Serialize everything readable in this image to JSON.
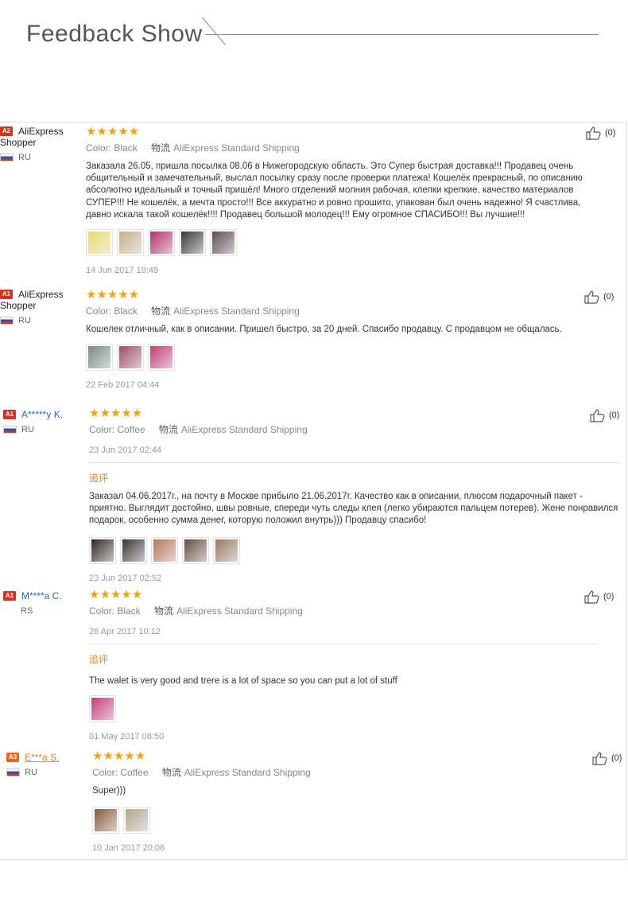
{
  "header": {
    "title": "Feedback Show"
  },
  "reviews": [
    {
      "level": "A2",
      "buyer_line1": "AliExpress",
      "buyer_line2": "Shopper",
      "country": "RU",
      "rating": "★★★★★",
      "color_label": "Color:",
      "color_value": "Black",
      "shipping_label": "物流",
      "shipping_value": "AliExpress Standard Shipping",
      "text": "Заказала 26.05, пришла посылка 08.06 в Нижегородскую область. Это Супер быстрая доставка!!! Продавец очень общительный и замечательный, выслал посылку сразу после проверки платежа! Кошелёк прекрасный, по описанию абсолютно идеальный и точный пришёл! Много отделений молния рабочая, клепки крепкие, качество материалов СУПЕР!!! Не кошелёк, а мечта просто!!! Все аккуратно и ровно прошито, упакован был очень надежно! Я счастлива, давно искала такой кошелёк!!!! Продавец большой молодец!!! Ему огромное СПАСИБО!!! Вы лучшие!!!",
      "date": "14 Jun 2017 19:49",
      "likes": "(0)",
      "thumb_colors": [
        "#e9dc6a",
        "#c9b08a",
        "#b52f6e",
        "#3a3535",
        "#5a4b57"
      ]
    },
    {
      "level": "A1",
      "buyer_line1": "AliExpress",
      "buyer_line2": "Shopper",
      "country": "RU",
      "rating": "★★★★★",
      "color_label": "Color:",
      "color_value": "Black",
      "shipping_label": "物流",
      "shipping_value": "AliExpress Standard Shipping",
      "text": "Кошелек отличный, как в описании. Пришел быстро, за 20 дней. Спасибо продавцу. С продавцом не общалась.",
      "date": "22 Feb 2017 04:44",
      "likes": "(0)",
      "thumb_colors": [
        "#7a8a86",
        "#a04a6a",
        "#c23a7a"
      ]
    },
    {
      "level": "A1",
      "buyer_name": "A*****y K.",
      "country": "RU",
      "rating": "★★★★★",
      "color_label": "Color:",
      "color_value": "Coffee",
      "shipping_label": "物流",
      "shipping_value": "AliExpress Standard Shipping",
      "date": "23 Jun 2017 02:44",
      "append_label": "追评",
      "text": "Заказал 04.06.2017г., на почту в Москве прибыло 21.06.2017г. Качество как в описании, плюсом подарочный пакет - приятно. Выглядит достойно, швы ровные, спереди чуть следы клея (легко убираются пальцем потерев). Жене понравился подарок, особенно сумма денег, которую положил внутрь))) Продавцу спасибо!",
      "append_date": "23 Jun 2017 02:52",
      "likes": "(0)",
      "thumb_colors": [
        "#2e2a22",
        "#3a3632",
        "#b8775e",
        "#6a4e3e",
        "#9a7a66"
      ]
    },
    {
      "level": "A1",
      "buyer_name": "M****a C.",
      "country": "RS",
      "rating": "★★★★★",
      "color_label": "Color:",
      "color_value": "Black",
      "shipping_label": "物流",
      "shipping_value": "AliExpress Standard Shipping",
      "date": "26 Apr 2017 10:12",
      "append_label": "追评",
      "text": "The walet is very good and trere is a lot of space so you can put a lot of stuff",
      "append_date": "01 May 2017 08:50",
      "likes": "(0)",
      "thumb_colors": [
        "#c93a7a"
      ]
    },
    {
      "level": "A3",
      "buyer_name": "E***a S.",
      "country": "RU",
      "rating": "★★★★★",
      "color_label": "Color:",
      "color_value": "Coffee",
      "shipping_label": "物流",
      "shipping_value": "AliExpress Standard Shipping",
      "text": "Super)))",
      "date": "10 Jan 2017 20:06",
      "likes": "(0)",
      "thumb_colors": [
        "#8a5a3a",
        "#b7a48a"
      ]
    }
  ]
}
